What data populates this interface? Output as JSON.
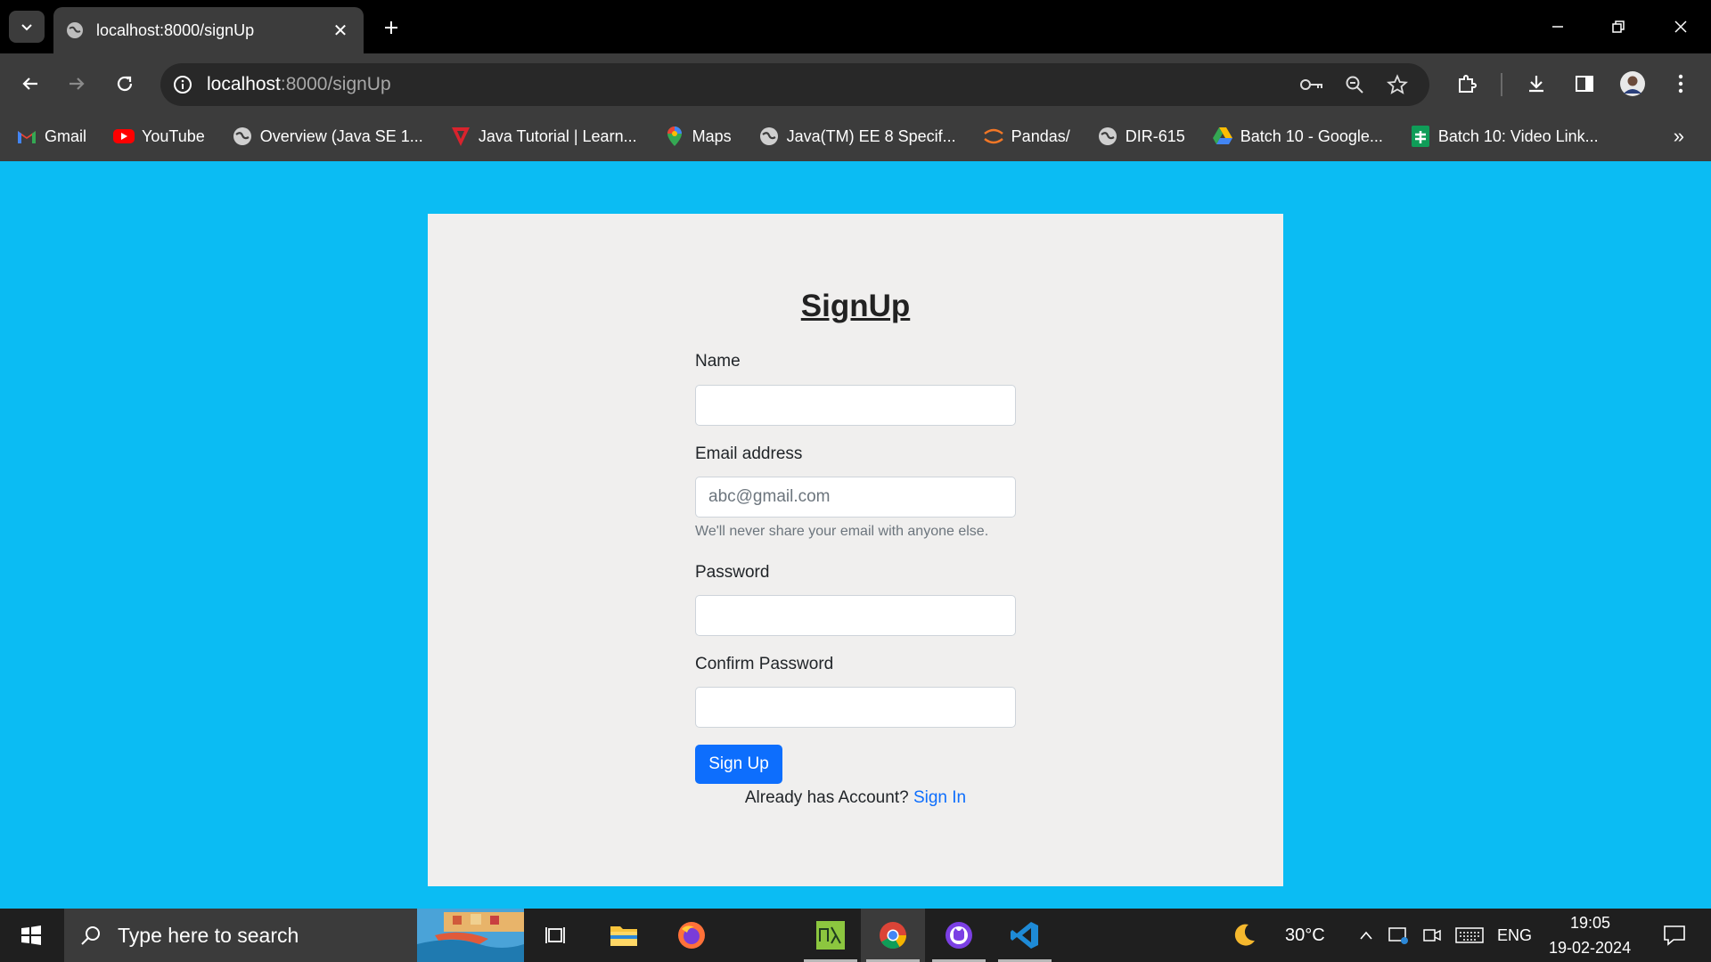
{
  "browser": {
    "tab_title": "localhost:8000/signUp",
    "url_host": "localhost",
    "url_path": ":8000/signUp",
    "bookmarks": [
      {
        "label": "Gmail",
        "icon": "gmail-icon"
      },
      {
        "label": "YouTube",
        "icon": "youtube-icon"
      },
      {
        "label": "Overview (Java SE 1...",
        "icon": "globe-icon"
      },
      {
        "label": "Java Tutorial | Learn...",
        "icon": "javatpoint-icon"
      },
      {
        "label": "Maps",
        "icon": "maps-icon"
      },
      {
        "label": "Java(TM) EE 8 Specif...",
        "icon": "globe-icon"
      },
      {
        "label": "Pandas/",
        "icon": "jupyter-icon"
      },
      {
        "label": "DIR-615",
        "icon": "globe-icon"
      },
      {
        "label": "Batch 10 - Google...",
        "icon": "google-drive-icon"
      },
      {
        "label": "Batch 10: Video Link...",
        "icon": "google-sheets-icon"
      }
    ]
  },
  "form": {
    "title": "SignUp",
    "name_label": "Name",
    "name_value": "",
    "email_label": "Email address",
    "email_placeholder": "abc@gmail.com",
    "email_help": "We'll never share your email with anyone else.",
    "password_label": "Password",
    "confirm_label": "Confirm Password",
    "submit_label": "Sign Up",
    "account_prompt": "Already has Account?",
    "signin_link": "Sign In"
  },
  "taskbar": {
    "search_placeholder": "Type here to search",
    "weather_temp": "30°C",
    "language": "ENG",
    "time": "19:05",
    "date": "19-02-2024"
  },
  "colors": {
    "page_bg": "#0bbcf3",
    "card_bg": "#f0efee",
    "button_primary": "#0d6efd",
    "link": "#0d6efd"
  }
}
